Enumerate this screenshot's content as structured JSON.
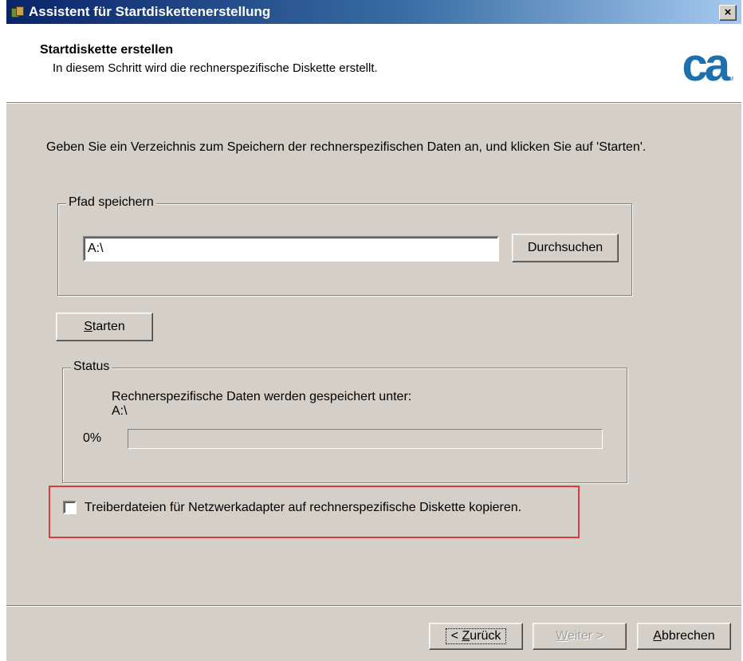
{
  "window": {
    "title": "Assistent für Startdiskettenerstellung",
    "close_symbol": "×",
    "icon": "wizard-app-icon"
  },
  "header": {
    "title": "Startdiskette erstellen",
    "subtitle": "In diesem Schritt wird die rechnerspezifische Diskette erstellt.",
    "logo_text": "ca",
    "logo_tm": "TM",
    "logo_color": "#1d6fae"
  },
  "instructions": "Geben Sie ein Verzeichnis zum Speichern der rechnerspezifischen Daten an, und klicken Sie auf 'Starten'.",
  "path_group": {
    "label": "Pfad speichern",
    "path_value": "A:\\",
    "browse_label": "Durchsuchen"
  },
  "start_button": {
    "accel": "S",
    "rest": "tarten"
  },
  "status_group": {
    "label": "Status",
    "message": "Rechnerspezifische Daten werden gespeichert unter:",
    "path": "A:\\",
    "progress_text": "0%",
    "progress_fraction": 0
  },
  "network_option": {
    "label": "Treiberdateien für Netzwerkadapter auf rechnerspezifische Diskette kopieren.",
    "checked": false,
    "highlight_color": "#e0393e"
  },
  "footer": {
    "back": {
      "prefix": "< ",
      "accel": "Z",
      "rest": "urück"
    },
    "next": {
      "accel": "W",
      "rest": "eiter >",
      "enabled": false
    },
    "cancel": {
      "accel": "A",
      "rest": "bbrechen"
    }
  }
}
